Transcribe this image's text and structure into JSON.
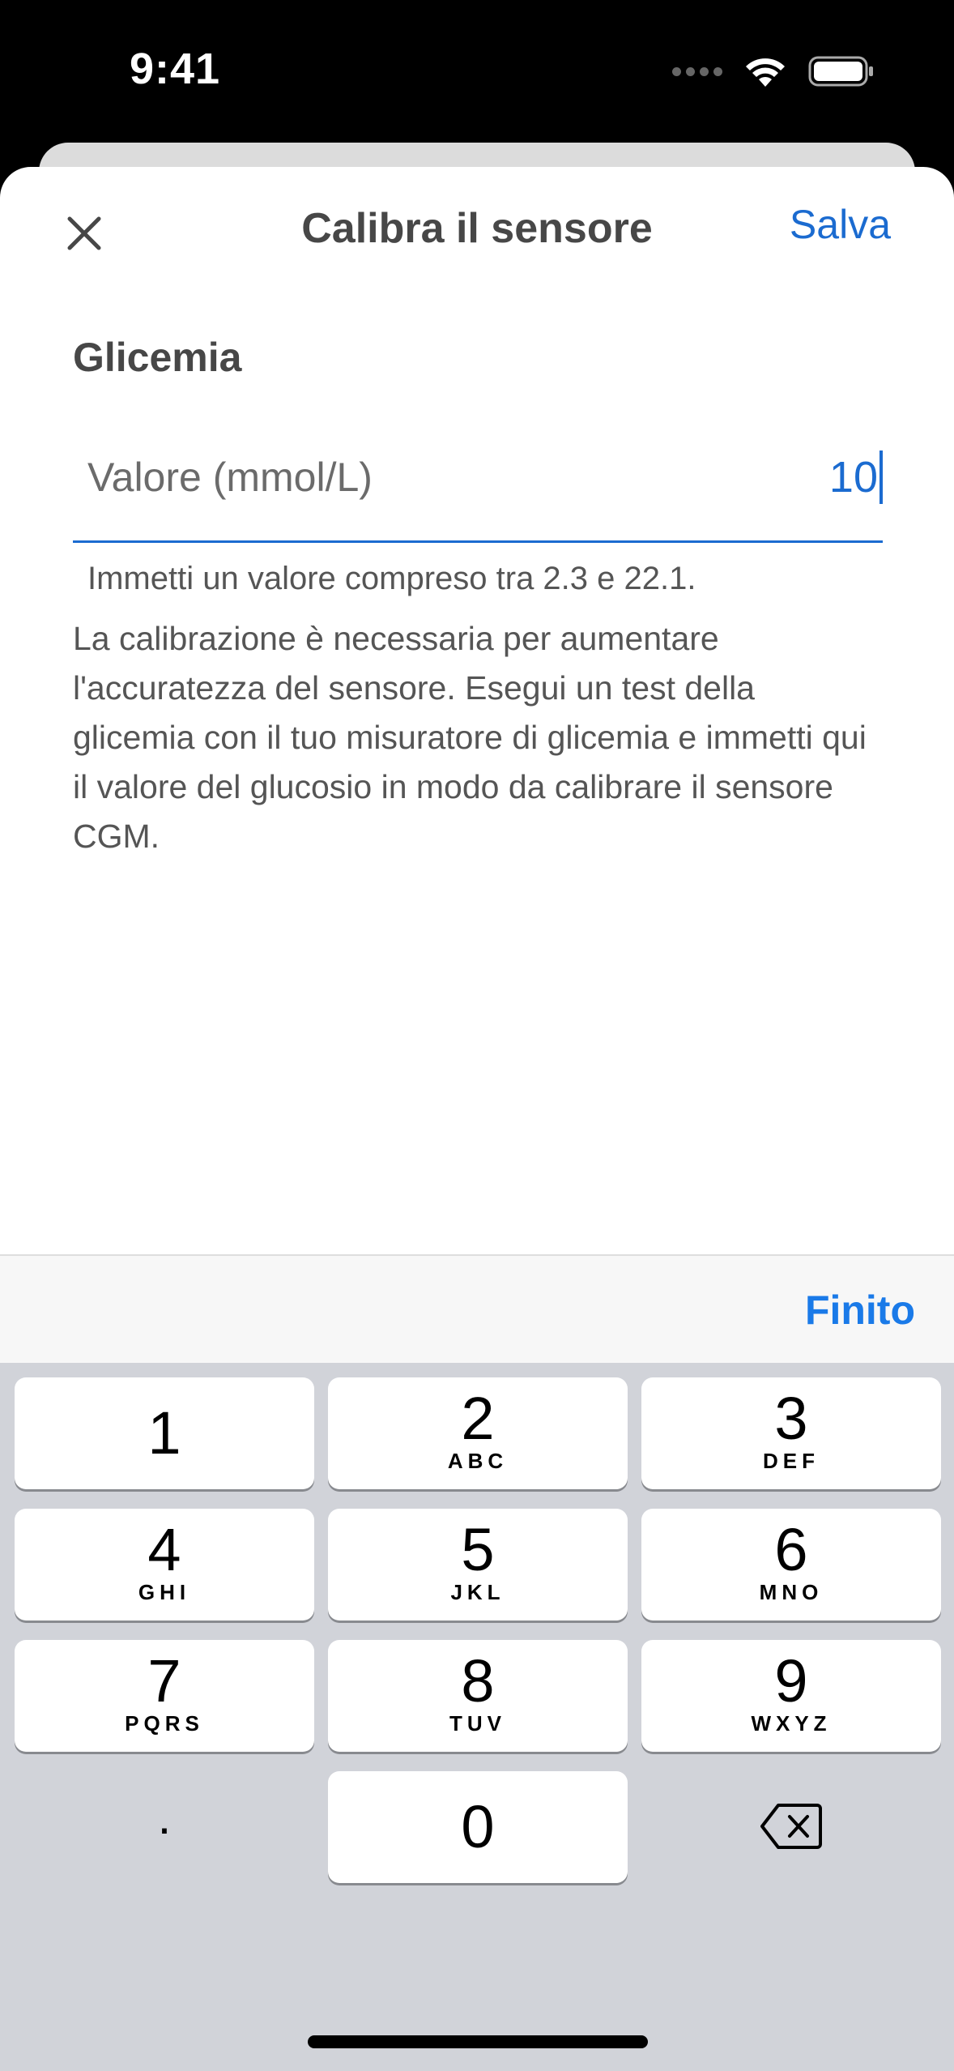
{
  "status_bar": {
    "time": "9:41",
    "icons": [
      "signal-dots-icon",
      "wifi-icon",
      "battery-icon"
    ]
  },
  "nav": {
    "title": "Calibra il sensore",
    "save_label": "Salva",
    "close_icon": "close-icon"
  },
  "form": {
    "section_label": "Glicemia",
    "input_label": "Valore (mmol/L)",
    "input_value": "10",
    "hint": "Immetti un valore compreso tra 2.3 e 22.1.",
    "description": "La calibrazione è necessaria per aumentare l'accuratezza del sensore. Esegui un test della glicemia con il tuo misuratore di glicemia e immetti qui il valore del glucosio in modo da calibrare il sensore CGM."
  },
  "accessory": {
    "done_label": "Finito"
  },
  "keyboard": {
    "keys": [
      {
        "digit": "1",
        "letters": ""
      },
      {
        "digit": "2",
        "letters": "ABC"
      },
      {
        "digit": "3",
        "letters": "DEF"
      },
      {
        "digit": "4",
        "letters": "GHI"
      },
      {
        "digit": "5",
        "letters": "JKL"
      },
      {
        "digit": "6",
        "letters": "MNO"
      },
      {
        "digit": "7",
        "letters": "PQRS"
      },
      {
        "digit": "8",
        "letters": "TUV"
      },
      {
        "digit": "9",
        "letters": "WXYZ"
      },
      {
        "digit": ".",
        "letters": ""
      },
      {
        "digit": "0",
        "letters": ""
      },
      {
        "digit": "",
        "letters": ""
      }
    ]
  },
  "colors": {
    "accent": "#1b6bd0",
    "done": "#1a7ae8",
    "keyboard_bg": "#d1d3d9",
    "text_dark": "#474747"
  }
}
